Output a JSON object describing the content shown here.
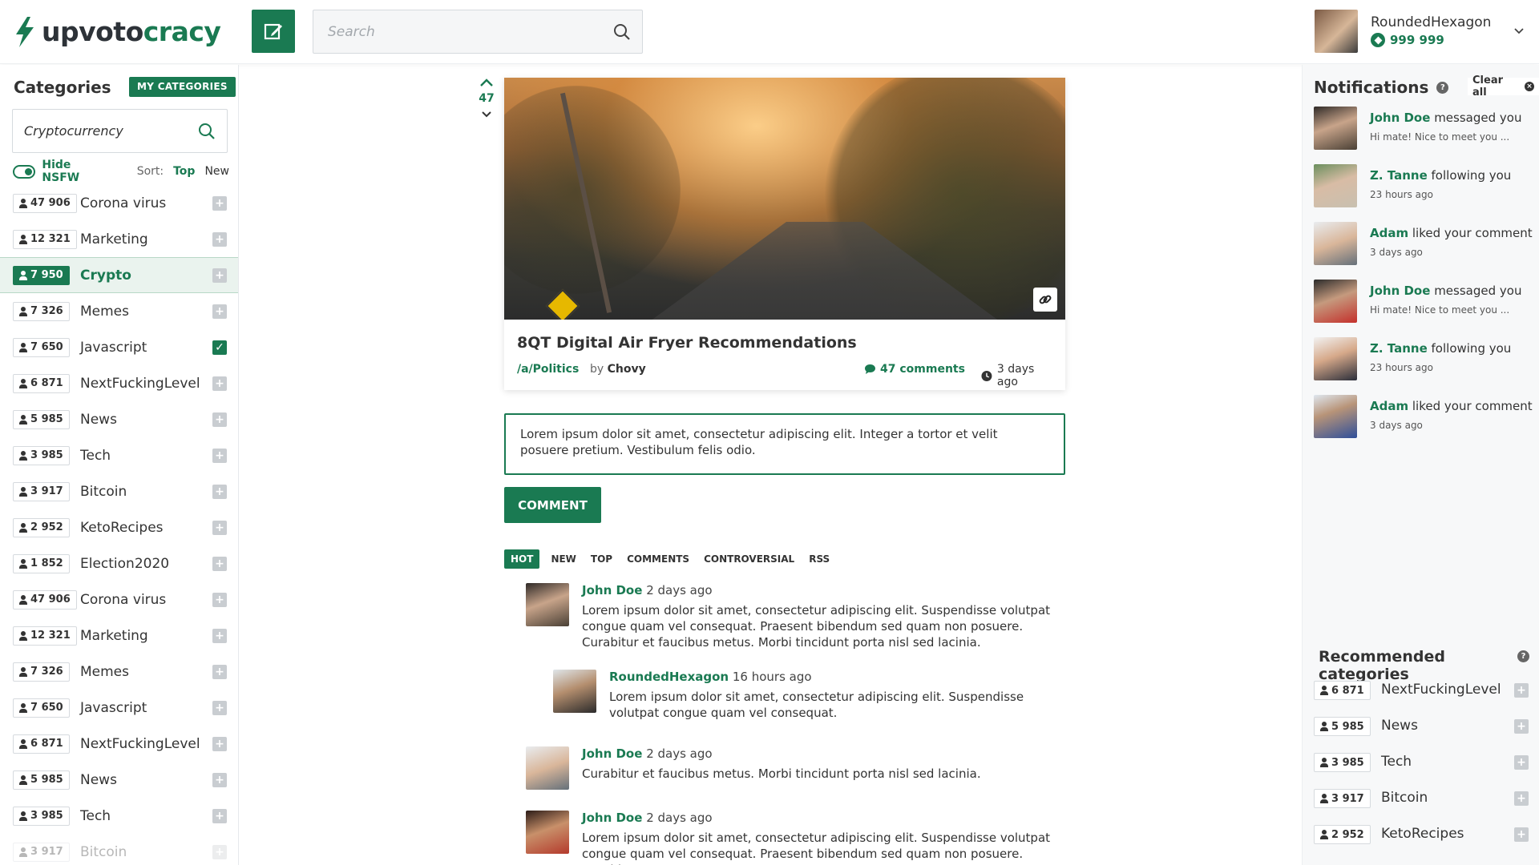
{
  "header": {
    "logo_text_a": "upvoto",
    "logo_text_b": "cracy",
    "search_placeholder": "Search",
    "user": {
      "name": "RoundedHexagon",
      "points": "999 999"
    }
  },
  "left_sidebar": {
    "title": "Categories",
    "my_categories_label": "MY CATEGORIES",
    "search_value": "Cryptocurrency",
    "hide_nsfw_label": "Hide NSFW",
    "sort_label": "Sort:",
    "sort_top": "Top",
    "sort_new": "New",
    "categories": [
      {
        "count": "47 906",
        "name": "Corona virus",
        "state": "add"
      },
      {
        "count": "12 321",
        "name": "Marketing",
        "state": "add"
      },
      {
        "count": "7 950",
        "name": "Crypto",
        "state": "add",
        "active": true
      },
      {
        "count": "7 326",
        "name": "Memes",
        "state": "add"
      },
      {
        "count": "7 650",
        "name": "Javascript",
        "state": "checked"
      },
      {
        "count": "6 871",
        "name": "NextFuckingLevel",
        "state": "add"
      },
      {
        "count": "5 985",
        "name": "News",
        "state": "add"
      },
      {
        "count": "3 985",
        "name": "Tech",
        "state": "add"
      },
      {
        "count": "3 917",
        "name": "Bitcoin",
        "state": "add"
      },
      {
        "count": "2 952",
        "name": "KetoRecipes",
        "state": "add"
      },
      {
        "count": "1 852",
        "name": "Election2020",
        "state": "add"
      },
      {
        "count": "47 906",
        "name": "Corona virus",
        "state": "add"
      },
      {
        "count": "12 321",
        "name": "Marketing",
        "state": "add"
      },
      {
        "count": "7 326",
        "name": "Memes",
        "state": "add"
      },
      {
        "count": "7 650",
        "name": "Javascript",
        "state": "add"
      },
      {
        "count": "6 871",
        "name": "NextFuckingLevel",
        "state": "add"
      },
      {
        "count": "5 985",
        "name": "News",
        "state": "add"
      },
      {
        "count": "3 985",
        "name": "Tech",
        "state": "add"
      },
      {
        "count": "3 917",
        "name": "Bitcoin",
        "state": "add"
      }
    ]
  },
  "post": {
    "votes": "47",
    "title": "8QT Digital Air Fryer Recommendations",
    "category": "/a/Politics",
    "by_label": "by",
    "author": "Chovy",
    "comments": "47 comments",
    "time": "3 days ago"
  },
  "comment_box": {
    "text": "Lorem ipsum dolor sit amet, consectetur adipiscing elit. Integer a tortor et velit posuere pretium. Vestibulum felis odio.",
    "button_label": "COMMENT"
  },
  "tabs": [
    "HOT",
    "NEW",
    "TOP",
    "COMMENTS",
    "CONTROVERSIAL",
    "RSS"
  ],
  "comments": [
    {
      "author": "John Doe",
      "time": "2 days ago",
      "text": "Lorem ipsum dolor sit amet, consectetur adipiscing elit. Suspendisse volutpat congue quam vel consequat. Praesent bibendum sed quam non posuere. Curabitur et faucibus metus. Morbi tincidunt porta nisl sed lacinia."
    },
    {
      "author": "RoundedHexagon",
      "time": "16 hours ago",
      "text": "Lorem ipsum dolor sit amet, consectetur adipiscing elit. Suspendisse volutpat congue quam vel consequat."
    },
    {
      "author": "John Doe",
      "time": "2 days ago",
      "text": "Curabitur et faucibus metus. Morbi tincidunt porta nisl sed lacinia."
    },
    {
      "author": "John Doe",
      "time": "2 days ago",
      "text": "Lorem ipsum dolor sit amet, consectetur adipiscing elit. Suspendisse volutpat congue quam vel consequat. Praesent bibendum sed quam non posuere. Curabitur et"
    }
  ],
  "notifications": {
    "title": "Notifications",
    "clear_label": "Clear all",
    "items": [
      {
        "name": "John Doe",
        "action": "messaged you",
        "sub": "Hi mate! Nice to meet you ..."
      },
      {
        "name": "Z. Tanne",
        "action": "following you",
        "sub": "23 hours ago"
      },
      {
        "name": "Adam",
        "action": "liked your comment",
        "sub": "3 days ago"
      },
      {
        "name": "John Doe",
        "action": "messaged you",
        "sub": "Hi mate! Nice to meet you ..."
      },
      {
        "name": "Z. Tanne",
        "action": "following you",
        "sub": "23 hours ago"
      },
      {
        "name": "Adam",
        "action": "liked your comment",
        "sub": "3 days ago"
      }
    ]
  },
  "recommended": {
    "title": "Recommended categories",
    "items": [
      {
        "count": "6 871",
        "name": "NextFuckingLevel"
      },
      {
        "count": "5 985",
        "name": "News"
      },
      {
        "count": "3 985",
        "name": "Tech"
      },
      {
        "count": "3 917",
        "name": "Bitcoin"
      },
      {
        "count": "2 952",
        "name": "KetoRecipes"
      }
    ]
  },
  "colors": {
    "brand": "#1a7a52",
    "badge_gray": "#c9cdd1"
  }
}
